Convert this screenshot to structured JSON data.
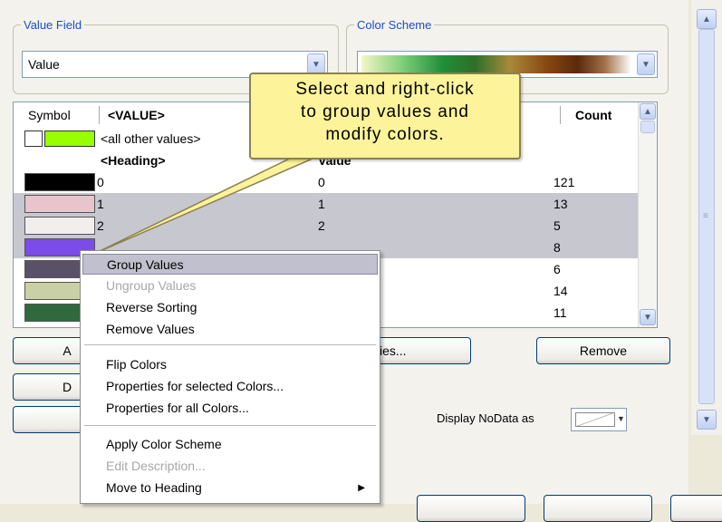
{
  "value_field": {
    "legend": "Value Field",
    "selected": "Value"
  },
  "color_scheme": {
    "legend": "Color Scheme"
  },
  "table": {
    "headers": {
      "symbol": "Symbol",
      "value": "<VALUE>",
      "count": "Count"
    },
    "all_other": {
      "label": "<all other values>",
      "color": "#99FF00"
    },
    "heading_row": {
      "label": "<Heading>",
      "value": "Value"
    },
    "rows": [
      {
        "label": "0",
        "value": "0",
        "count": "121",
        "color": "#000000",
        "selected": false
      },
      {
        "label": "1",
        "value": "1",
        "count": "13",
        "color": "#E8C4CC",
        "selected": true
      },
      {
        "label": "2",
        "value": "2",
        "count": "5",
        "color": "#F2EEEC",
        "selected": true
      },
      {
        "label": "",
        "value": "",
        "count": "8",
        "color": "#7B4CE8",
        "selected": true
      },
      {
        "label": "",
        "value": "",
        "count": "6",
        "color": "#5A5068",
        "selected": false
      },
      {
        "label": "",
        "value": "",
        "count": "14",
        "color": "#C9D0A6",
        "selected": false
      },
      {
        "label": "",
        "value": "",
        "count": "11",
        "color": "#2E6A3E",
        "selected": false
      }
    ]
  },
  "buttons": {
    "add": "A",
    "values": "ies...",
    "remove": "Remove",
    "default": "D"
  },
  "nodata": {
    "label": "Display NoData as"
  },
  "context_menu": {
    "group_values": "Group Values",
    "ungroup_values": "Ungroup Values",
    "reverse_sorting": "Reverse Sorting",
    "remove_values": "Remove Values",
    "flip_colors": "Flip Colors",
    "props_selected": "Properties for selected Colors...",
    "props_all": "Properties for all Colors...",
    "apply_scheme": "Apply Color Scheme",
    "edit_description": "Edit Description...",
    "move_to_heading": "Move to Heading"
  },
  "callout": {
    "line1": "Select and right-click",
    "line2": "to group values and",
    "line3": "modify colors."
  }
}
